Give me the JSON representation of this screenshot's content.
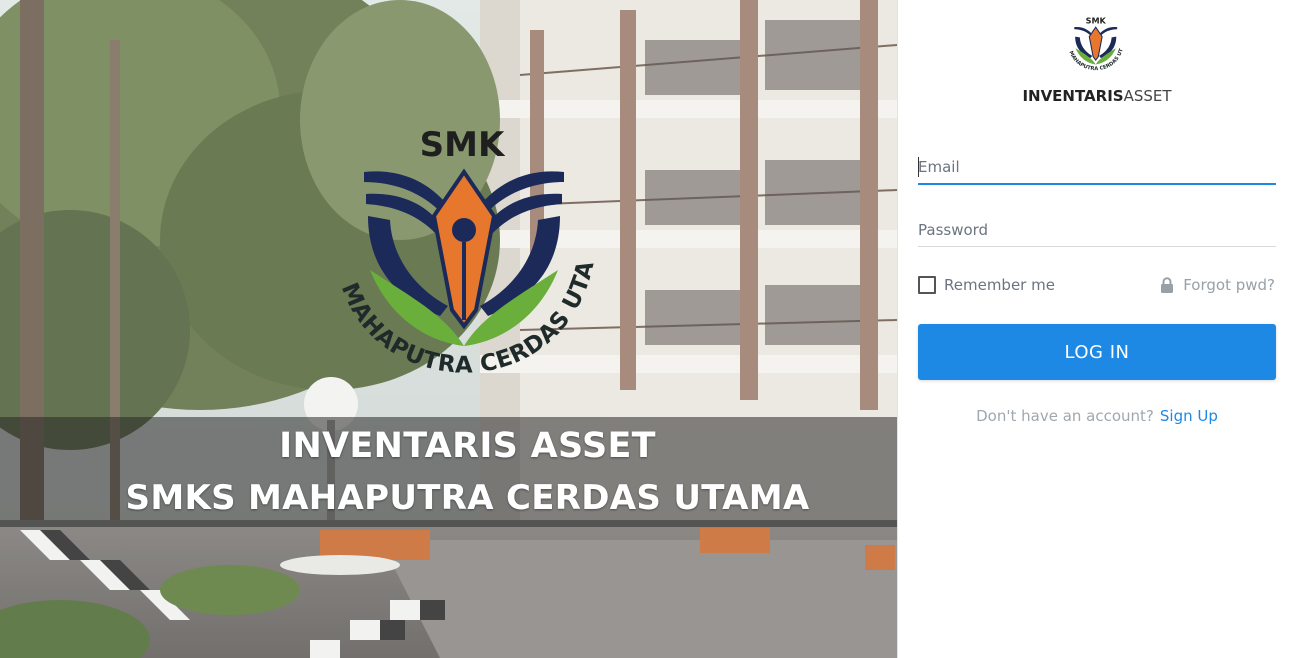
{
  "hero": {
    "logo_text_top": "SMK",
    "logo_text_arc": "MAHAPUTRA CERDAS UTAMA",
    "title_line1": "INVENTARIS ASSET",
    "title_line2": "SMKS MAHAPUTRA CERDAS UTAMA"
  },
  "brand": {
    "logo_text_top": "SMK",
    "logo_text_arc": "MAHAPUTRA CERDAS UTAMA",
    "name_bold": "INVENTARIS",
    "name_light": "ASSET"
  },
  "form": {
    "email_placeholder": "Email",
    "email_value": "",
    "password_placeholder": "Password",
    "password_value": "",
    "remember_label": "Remember me",
    "remember_checked": false,
    "forgot_label": "Forgot pwd?",
    "login_label": "LOG IN",
    "signup_prompt": "Don't have an account?",
    "signup_link": "Sign Up"
  },
  "colors": {
    "accent": "#1e88e5",
    "logo_navy": "#1c2a5a",
    "logo_orange": "#e8772e",
    "logo_green": "#6aae3c"
  },
  "icons": {
    "lock": "lock-icon",
    "checkbox": "checkbox-icon"
  }
}
